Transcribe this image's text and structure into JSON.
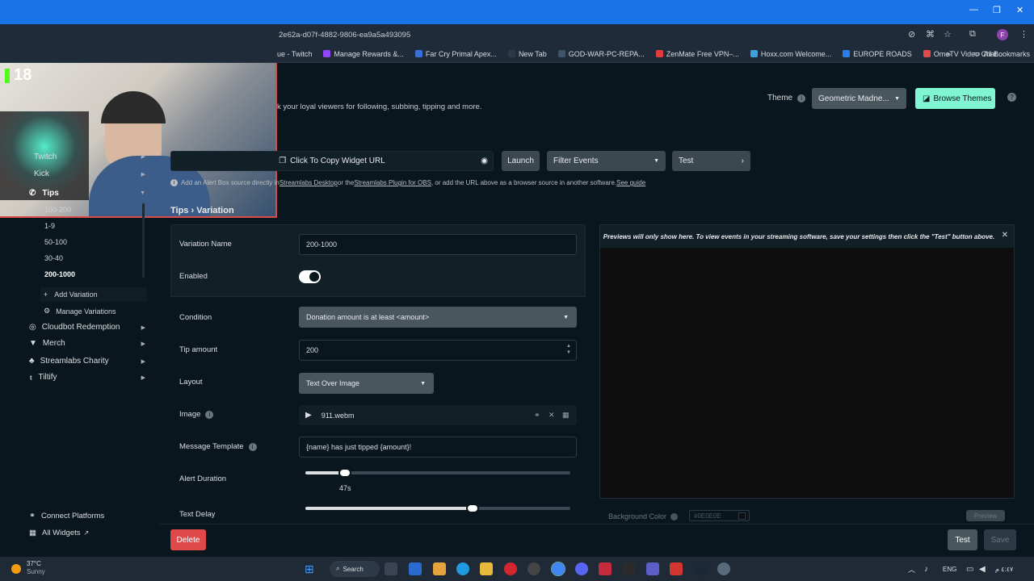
{
  "browser": {
    "url": "2e62a-d07f-4882-9806-ea9a5a493095",
    "bookmarks": [
      "ue - Twitch",
      "Manage Rewards &...",
      "Far Cry Primal Apex...",
      "New Tab",
      "GOD-WAR-PC-REPA...",
      "ZenMate Free VPN–...",
      "Hoxx.com Welcome...",
      "EUROPE ROADS",
      "OmeTV Video Chat..."
    ],
    "all_bookmarks": "All Bookmarks",
    "more": "»",
    "avatar": "F"
  },
  "webcam": {
    "counter": "18"
  },
  "header": {
    "subtitle": "k your loyal viewers for following, subbing, tipping and more.",
    "theme_label": "Theme",
    "theme_value": "Geometric Madne...",
    "browse_themes": "Browse Themes",
    "help": "?"
  },
  "toolbar": {
    "copy_url": "Click To Copy Widget URL",
    "launch": "Launch",
    "filter_events": "Filter Events",
    "test": "Test"
  },
  "info": {
    "text1": "Add an Alert Box source directly in ",
    "link1": "Streamlabs Desktop",
    "text2": " or the ",
    "link2": "Streamlabs Plugin for OBS",
    "text3": ", or add the URL above as a browser source in another software. ",
    "link3": "See guide"
  },
  "sidebar": {
    "twitch": "Twitch",
    "kick": "Kick",
    "tips": "Tips",
    "variations": [
      "100-200",
      "1-9",
      "50-100",
      "30-40",
      "200-1000"
    ],
    "add_variation": "Add Variation",
    "manage_variations": "Manage Variations",
    "cloudbot": "Cloudbot Redemption",
    "merch": "Merch",
    "charity": "Streamlabs Charity",
    "tiltify": "Tiltify",
    "connect_platforms": "Connect Platforms",
    "all_widgets": "All Widgets"
  },
  "breadcrumb": {
    "parent": "Tips",
    "sep": "›",
    "current": "Variation"
  },
  "form": {
    "variation_name_label": "Variation Name",
    "variation_name_value": "200-1000",
    "enabled_label": "Enabled",
    "enabled": true,
    "condition_label": "Condition",
    "condition_value": "Donation amount is at least <amount>",
    "tip_amount_label": "Tip amount",
    "tip_amount_value": "200",
    "layout_label": "Layout",
    "layout_value": "Text Over Image",
    "image_label": "Image",
    "image_value": "911.webm",
    "message_template_label": "Message Template",
    "message_template_value": "{name} has just tipped {amount}!",
    "alert_duration_label": "Alert Duration",
    "alert_duration_value": "47s",
    "alert_duration_level": 0.15,
    "text_delay_label": "Text Delay",
    "text_delay_level": 0.63
  },
  "preview": {
    "notice": "Previews will only show here. To view events in your streaming software, save your settings then click the \"Test\" button above.",
    "bg_color_label": "Background Color",
    "bg_color_value": "#0E0E0E",
    "preview_button": "Preview"
  },
  "footer": {
    "delete": "Delete",
    "test": "Test",
    "save": "Save"
  },
  "taskbar": {
    "weather_temp": "37°C",
    "weather_desc": "Sunny",
    "search": "Search",
    "lang": "ENG",
    "clock": "٤:٤٧ م"
  },
  "colors": {
    "accent": "#80f5d2",
    "danger": "#e0494a",
    "chrome": "#1a73e8"
  }
}
